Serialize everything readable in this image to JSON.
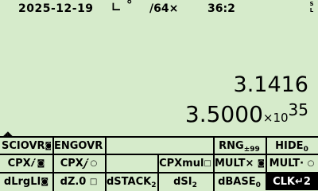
{
  "status": {
    "date": "2025-12-19",
    "angle_glyph": "∟",
    "degree_glyph": "°",
    "fraction_mode": "/64×",
    "display_mode": "36:2",
    "flags": [
      "S",
      "L"
    ]
  },
  "stack": {
    "y": "3.1416",
    "x_mantissa": "3.5000",
    "x_times": "×10",
    "x_exponent": "35"
  },
  "menu": {
    "caret": "◢◣",
    "row0": [
      {
        "label": "SCIOVR",
        "ind": "◙"
      },
      {
        "label": "ENGOVR",
        "ind": "◘"
      },
      {
        "label": ""
      },
      {
        "label": ""
      },
      {
        "label": "RNG",
        "sub": "±99"
      },
      {
        "label": "HIDE",
        "sub": "0"
      }
    ],
    "row1": [
      {
        "label": "CPX",
        "ital": "𝑖",
        "ind": "◙"
      },
      {
        "label": "CPX",
        "ital": "𝑗",
        "ind": "○"
      },
      {
        "label": ""
      },
      {
        "label": "CPXmul",
        "ind": "□"
      },
      {
        "label": "MULT×",
        "ind": "◙"
      },
      {
        "label": "MULT·",
        "ind": "○"
      }
    ],
    "row2": [
      {
        "label": "dLrgLI",
        "ind": "◙"
      },
      {
        "label": "dZ.0",
        "ind": "□"
      },
      {
        "label": "dSTACK",
        "sub": "2"
      },
      {
        "label": "dSI",
        "sub": "2"
      },
      {
        "label": "dBASE",
        "sub": "0"
      },
      {
        "label": "CLK↵2"
      }
    ]
  }
}
